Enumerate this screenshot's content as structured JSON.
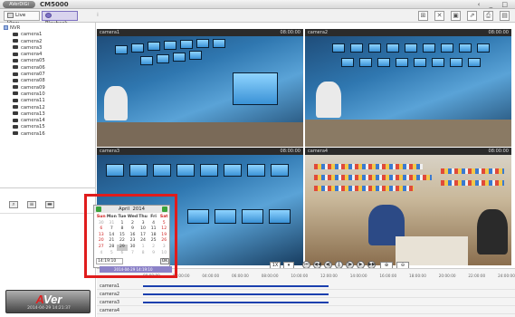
{
  "window": {
    "logo_text": "AVerDiGi",
    "title": "CM5000",
    "controls": "‹ _ □"
  },
  "toolbar": {
    "live_view_label": "Live View",
    "playback_label": "Playback",
    "right_icons": [
      "grid-icon",
      "fullscreen-icon",
      "snapshot-icon",
      "export-icon",
      "print-icon",
      "settings-icon"
    ]
  },
  "tree": {
    "root": "NVR",
    "cameras": [
      "camera1",
      "camera2",
      "camera3",
      "camera4",
      "camera05",
      "camera06",
      "camera07",
      "camera08",
      "camera09",
      "camera10",
      "camera11",
      "camera12",
      "camera13",
      "camera14",
      "camera15",
      "camera16"
    ]
  },
  "tiles": [
    {
      "name": "camera1",
      "time": "08:00:00"
    },
    {
      "name": "camera2",
      "time": "08:00:00"
    },
    {
      "name": "camera3",
      "time": "08:00:00"
    },
    {
      "name": "camera4",
      "time": "08:00:00"
    }
  ],
  "calendar": {
    "month": "April",
    "year": "2014",
    "days_of_week": [
      "Sun",
      "Mon",
      "Tue",
      "Wed",
      "Thu",
      "Fri",
      "Sat"
    ],
    "weeks": [
      [
        "30",
        "31",
        "1",
        "2",
        "3",
        "4",
        "5"
      ],
      [
        "6",
        "7",
        "8",
        "9",
        "10",
        "11",
        "12"
      ],
      [
        "13",
        "14",
        "15",
        "16",
        "17",
        "18",
        "19"
      ],
      [
        "20",
        "21",
        "22",
        "23",
        "24",
        "25",
        "26"
      ],
      [
        "27",
        "28",
        "29",
        "30",
        "1",
        "2",
        "3"
      ],
      [
        "4",
        "5",
        "6",
        "7",
        "8",
        "9",
        "10"
      ]
    ],
    "selected_day": "29",
    "time_value": "14:19:10",
    "ok_label": "OK",
    "bar_text": "2014-04-29 14:19:10"
  },
  "playback": {
    "speed_label": "1X",
    "buttons": [
      "prev-day",
      "rewind",
      "step-back",
      "pause",
      "step-forward",
      "play",
      "fast-forward",
      "next-day"
    ]
  },
  "timeline": {
    "ticks": [
      "00:00:00",
      "02:00:00",
      "04:00:00",
      "06:00:00",
      "08:00:00",
      "10:00:00",
      "12:00:00",
      "14:00:00",
      "16:00:00",
      "18:00:00",
      "20:00:00",
      "22:00:00",
      "24:00:00"
    ],
    "tracks": [
      {
        "label": "camera1",
        "start_frac": 0.0,
        "end_frac": 0.5
      },
      {
        "label": "camera2",
        "start_frac": 0.0,
        "end_frac": 0.5
      },
      {
        "label": "camera3",
        "start_frac": 0.0,
        "end_frac": 0.5
      },
      {
        "label": "camera4",
        "start_frac": 0.0,
        "end_frac": 0.0
      }
    ]
  },
  "brand": {
    "logo_text": "AVer",
    "datetime": "2014-04-29 14:21:37"
  },
  "colors": {
    "track": "#1a3fae",
    "highlight": "#e01c1c",
    "accent": "#7d71c4"
  }
}
